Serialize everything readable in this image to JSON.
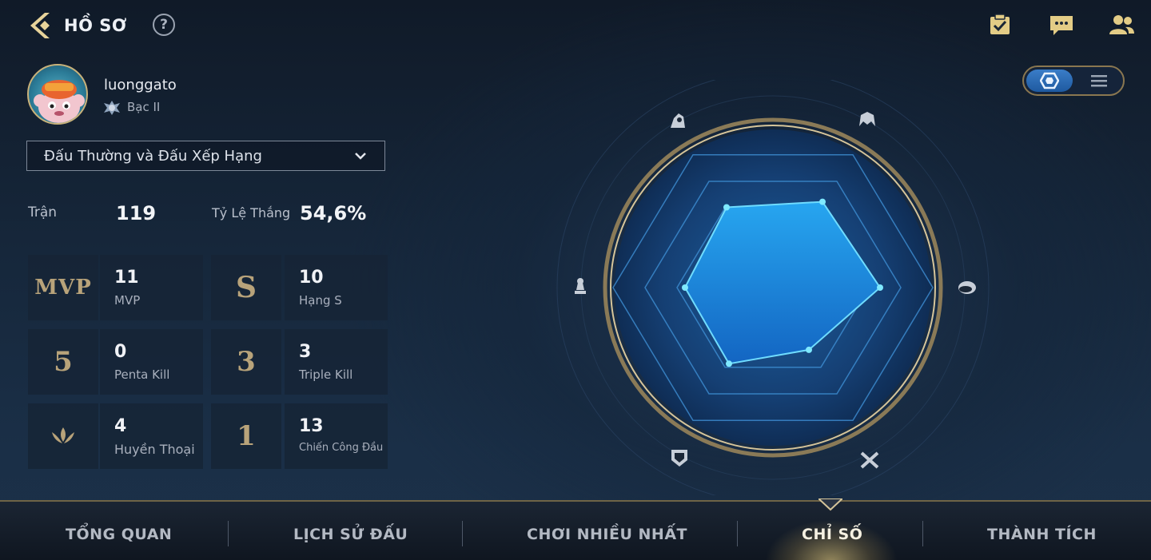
{
  "header": {
    "title": "HỒ SƠ",
    "help_label": "?",
    "icons": [
      "back-icon",
      "help-icon",
      "task-checklist-icon",
      "chat-icon",
      "friends-icon"
    ]
  },
  "profile": {
    "username": "luonggato",
    "rank": "Bạc II"
  },
  "mode_select": {
    "value": "Đấu Thường và Đấu Xếp Hạng"
  },
  "summary": {
    "matches_label": "Trận",
    "matches_value": "119",
    "winrate_label": "Tỷ Lệ Thắng",
    "winrate_value": "54,6%"
  },
  "stats": [
    {
      "glyph": "MVP",
      "value": "11",
      "label": "MVP"
    },
    {
      "glyph": "S",
      "value": "10",
      "label": "Hạng S"
    },
    {
      "glyph": "5",
      "value": "0",
      "label": "Penta Kill"
    },
    {
      "glyph": "3",
      "value": "3",
      "label": "Triple Kill"
    },
    {
      "glyph": "",
      "value": "4",
      "label": "Huyền Thoại"
    },
    {
      "glyph": "1",
      "value": "13",
      "label": "Chiến Công Đầu"
    }
  ],
  "radar": {
    "axes": [
      "assassin-icon",
      "fighter-icon",
      "mage-icon",
      "tank-icon",
      "support-icon",
      "marksman-icon"
    ],
    "levels": [
      0.58,
      0.62,
      0.67,
      0.55,
      0.55,
      0.45
    ]
  },
  "tabs": [
    {
      "label": "TỔNG QUAN",
      "active": false
    },
    {
      "label": "LỊCH SỬ ĐẤU",
      "active": false
    },
    {
      "label": "CHƠI NHIỀU NHẤT",
      "active": false
    },
    {
      "label": "CHỈ SỐ",
      "active": true
    },
    {
      "label": "THÀNH TÍCH",
      "active": false
    }
  ],
  "colors": {
    "accent_gold": "#c9b27a",
    "radar_fill": "#1f8fe0",
    "radar_point": "#7fe9ff",
    "toggle_active": "#2b6db8"
  }
}
